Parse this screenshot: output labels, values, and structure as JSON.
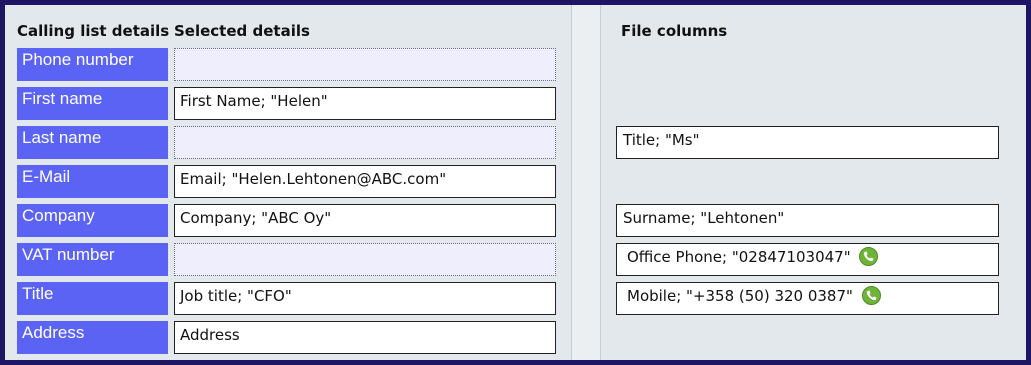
{
  "left": {
    "header_labels": "Calling list details",
    "header_selected": "Selected details",
    "rows": [
      {
        "label": "Phone number",
        "value": ""
      },
      {
        "label": "First name",
        "value": "First Name; \"Helen\""
      },
      {
        "label": "Last name",
        "value": ""
      },
      {
        "label": "E-Mail",
        "value": "Email; \"Helen.Lehtonen@ABC.com\""
      },
      {
        "label": "Company",
        "value": "Company; \"ABC Oy\""
      },
      {
        "label": "VAT number",
        "value": ""
      },
      {
        "label": "Title",
        "value": "Job title; \"CFO\""
      },
      {
        "label": "Address",
        "value": "Address"
      }
    ]
  },
  "right": {
    "header": "File columns",
    "fields": [
      {
        "value": "Title; \"Ms\"",
        "icon": ""
      },
      {
        "value": "Surname; \"Lehtonen\"",
        "icon": ""
      },
      {
        "value": "Office Phone; \"02847103047\"",
        "icon": "phone-call-icon"
      },
      {
        "value": "Mobile; \"+358 (50) 320 0387\"",
        "icon": "phone-call-icon"
      }
    ]
  },
  "colors": {
    "label_bg": "#5b63f5",
    "frame": "#1e1565",
    "panel_bg": "#e3e8ec",
    "empty_field_bg": "#eeeefd",
    "phone_icon": "#6fb43a"
  }
}
